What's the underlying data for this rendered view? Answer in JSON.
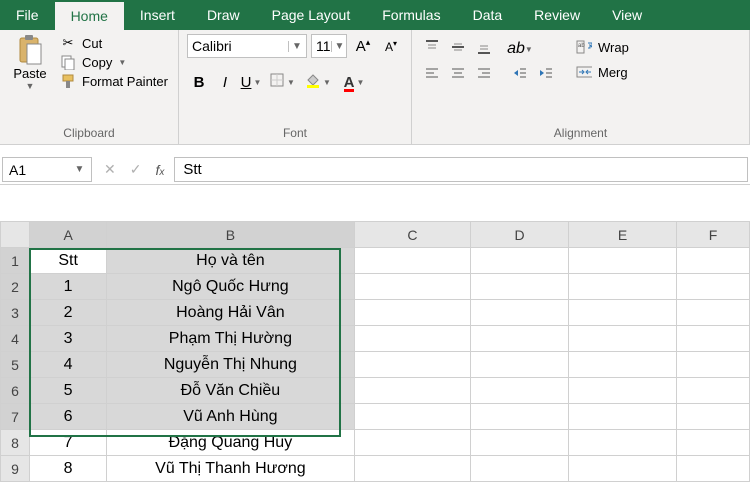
{
  "tabs": {
    "file": "File",
    "home": "Home",
    "insert": "Insert",
    "draw": "Draw",
    "pageLayout": "Page Layout",
    "formulas": "Formulas",
    "data": "Data",
    "review": "Review",
    "view": "View"
  },
  "clipboard": {
    "paste": "Paste",
    "cut": "Cut",
    "copy": "Copy",
    "formatPainter": "Format Painter",
    "groupLabel": "Clipboard"
  },
  "font": {
    "name": "Calibri",
    "size": "11",
    "groupLabel": "Font"
  },
  "alignment": {
    "wrap": "Wrap",
    "merge": "Merg",
    "groupLabel": "Alignment"
  },
  "nameBox": "A1",
  "formula": "Stt",
  "columns": [
    "A",
    "B",
    "C",
    "D",
    "E",
    "F"
  ],
  "rows": [
    {
      "n": "1",
      "a": "Stt",
      "b": "Họ và tên"
    },
    {
      "n": "2",
      "a": "1",
      "b": "Ngô Quốc Hưng"
    },
    {
      "n": "3",
      "a": "2",
      "b": "Hoàng Hải Vân"
    },
    {
      "n": "4",
      "a": "3",
      "b": "Phạm Thị Hường"
    },
    {
      "n": "5",
      "a": "4",
      "b": "Nguyễn Thị Nhung"
    },
    {
      "n": "6",
      "a": "5",
      "b": "Đỗ Văn Chiều"
    },
    {
      "n": "7",
      "a": "6",
      "b": "Vũ Anh Hùng"
    },
    {
      "n": "8",
      "a": "7",
      "b": "Đặng Quang Huy"
    },
    {
      "n": "9",
      "a": "8",
      "b": "Vũ Thị Thanh Hương"
    }
  ]
}
